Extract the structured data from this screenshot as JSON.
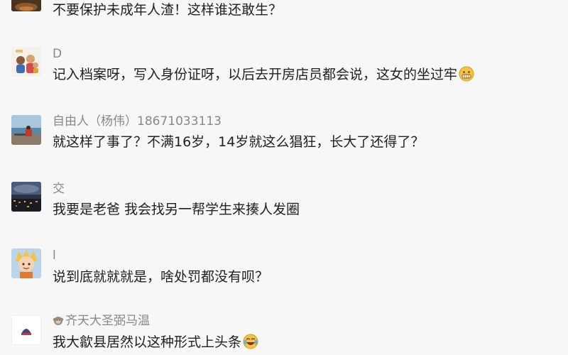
{
  "comments": [
    {
      "nickname": "",
      "text": "不要保护未成年人渣！这样谁还敢生？",
      "avatar": "dark-landscape-avatar"
    },
    {
      "nickname": "D",
      "text": "记入档案呀，写入身份证呀，以后去开房店员都会说，这女的坐过牢",
      "avatar": "cartoon-family-avatar",
      "emoji": "grimace-emoji"
    },
    {
      "nickname": "自由人（杨伟）18671033113",
      "text": "就这样了事了？不满16岁，14岁就这么猖狂，长大了还得了？",
      "avatar": "seaside-photo-avatar"
    },
    {
      "nickname": "交",
      "text": "我要是老爸 我会找另一帮学生来揍人发圈",
      "avatar": "city-night-avatar"
    },
    {
      "nickname": "l",
      "text": "说到底就就就是，啥处罚都没有呗？",
      "avatar": "anime-character-avatar"
    },
    {
      "nickname": "齐天大圣弼马温",
      "nickname_icon": "monkey-icon",
      "text": "我大歙县居然以这种形式上头条",
      "avatar": "white-logo-avatar",
      "emoji": "laugh-cry-emoji"
    }
  ],
  "colors": {
    "background": "#f7f7f7",
    "nickname": "#888888",
    "text": "#1f1f1f"
  }
}
